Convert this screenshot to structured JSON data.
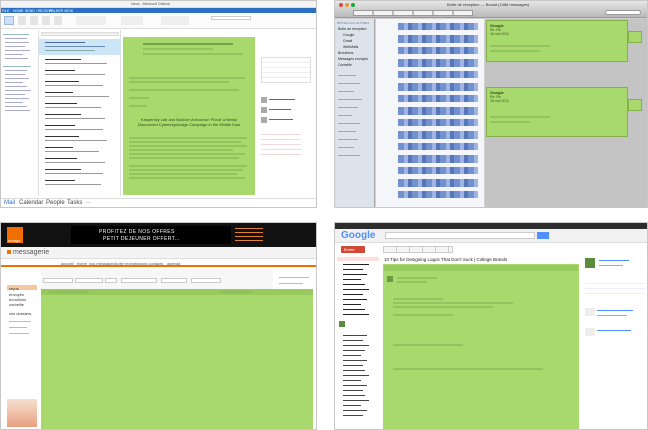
{
  "outlook": {
    "title": "Inbox - Microsoft Outlook",
    "ribbon_tabs": [
      "FILE",
      "HOME",
      "SEND / RECEIVE",
      "FOLDER",
      "VIEW"
    ],
    "nav_bar": [
      "Mail",
      "Calendar",
      "People",
      "Tasks",
      "···"
    ],
    "email_heading": "Kaspersky Lab and Boulder Announce ‘Flood’ a Newly Discovered Cyberespionage Campaign in the Middle East",
    "colors": {
      "blue": "#2b6fc2",
      "green": "#a8d96c"
    }
  },
  "mac_mail": {
    "title": "Boîte de réception — Boulot (2488 messages)",
    "sidebar_heading": "BOÎTES AUX LETTRES",
    "sidebar_items": [
      "Boîte de réception",
      "Google",
      "Gmail",
      "WebMails",
      "Brouillons",
      "Messages envoyés",
      "Corbeille"
    ],
    "message_sender": "Google",
    "message_subject": "Re: Re",
    "message_date": "16 mai 2011",
    "colors": {
      "green": "#a8d96c",
      "chrome": "#c9c9c9"
    }
  },
  "orange_mail": {
    "brand": "orange",
    "banner_text": [
      "PROFITEZ DE NOS OFFRES",
      "PETIT DEJEUNER OFFERT..."
    ],
    "app_name": "messagerie",
    "menu_tabs": [
      "accueil",
      "écrire",
      "vos messages",
      "boîte reception",
      "vos contacts",
      "agenda"
    ],
    "folders": [
      "reçus",
      "envoyés",
      "brouillons",
      "corbeille",
      "vos dossiers"
    ],
    "colors": {
      "orange": "#f16e00",
      "green": "#a8d96c"
    }
  },
  "gmail": {
    "brand": "Google",
    "compose": "Écrire",
    "email_subject": "10 Tips for Designing Logos That Don't Suck | College Brands",
    "colors": {
      "red": "#d14836",
      "green": "#a8d96c",
      "blue": "#4d90fe"
    }
  }
}
